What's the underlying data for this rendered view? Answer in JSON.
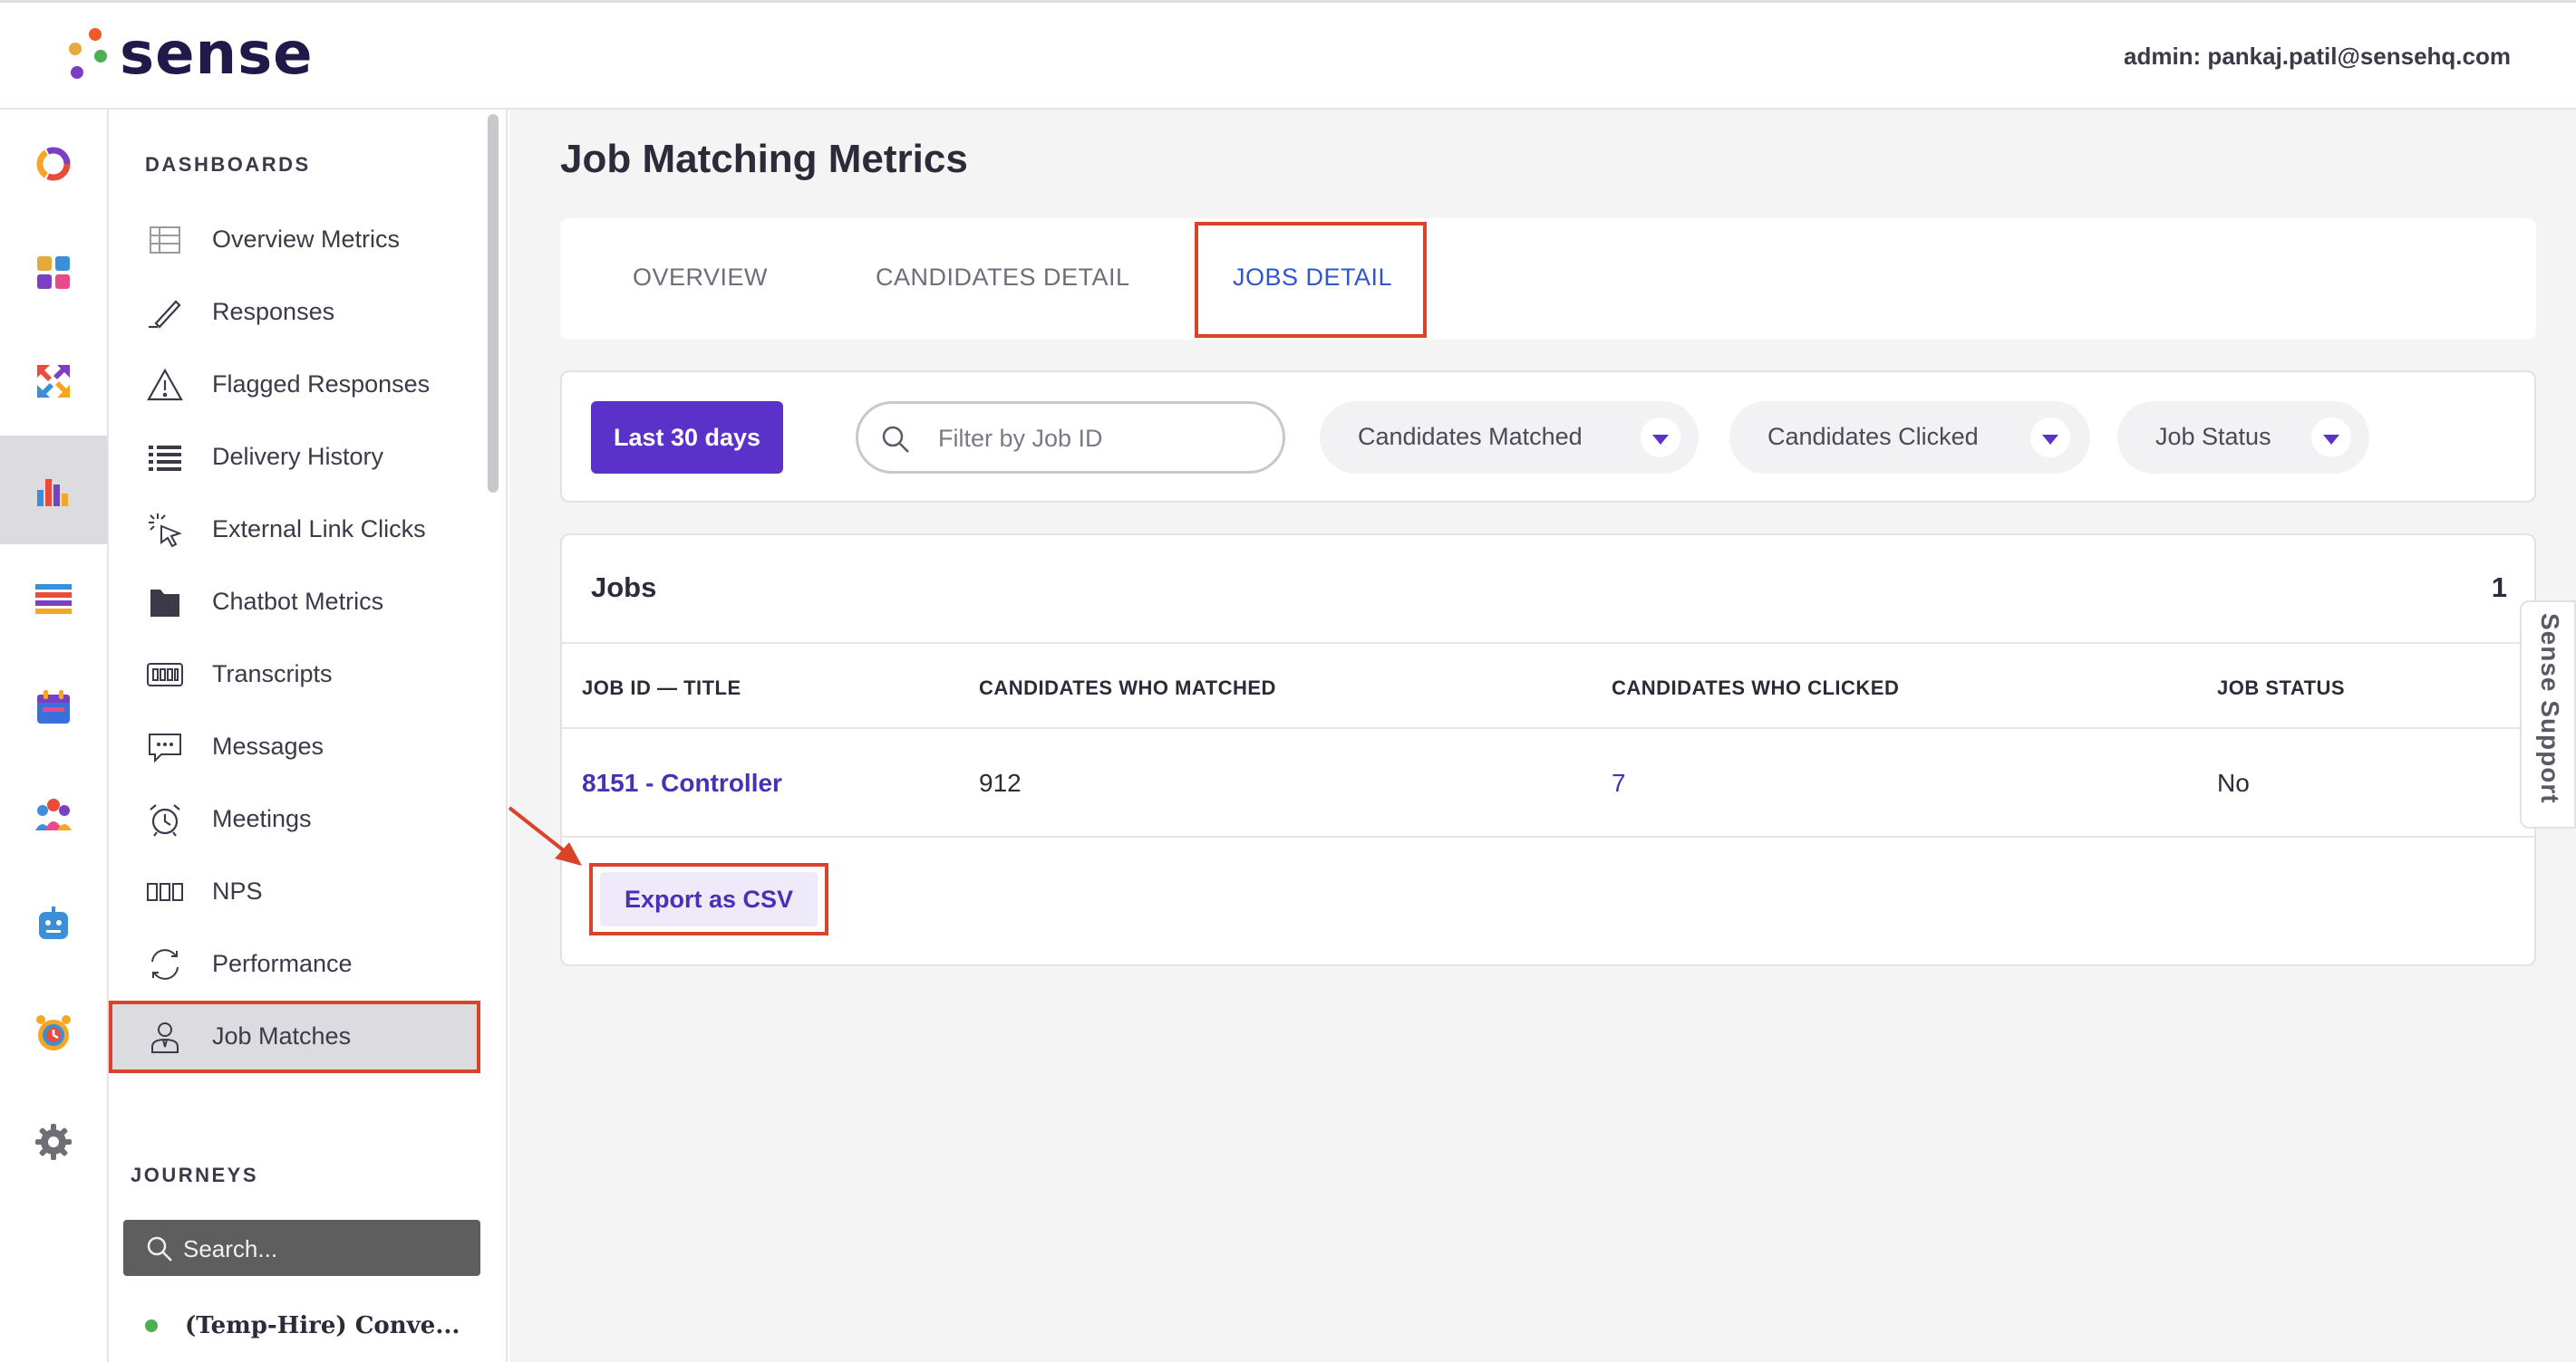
{
  "brand": {
    "name": "sense",
    "dot_colors": [
      "#f15a24",
      "#e8a93b",
      "#4caf50",
      "#7b3fc4",
      "#f5c542"
    ]
  },
  "header": {
    "admin": "admin: pankaj.patil@sensehq.com"
  },
  "rail": {
    "items": [
      {
        "icon": "ring-icon"
      },
      {
        "icon": "grid-icon"
      },
      {
        "icon": "arrows-icon"
      },
      {
        "icon": "bar-chart-icon",
        "active": true
      },
      {
        "icon": "list-icon"
      },
      {
        "icon": "calendar-icon"
      },
      {
        "icon": "team-icon"
      },
      {
        "icon": "bot-icon"
      },
      {
        "icon": "alarm-icon"
      },
      {
        "icon": "gear-icon"
      }
    ]
  },
  "sidebar": {
    "section_label": "DASHBOARDS",
    "items": [
      {
        "label": "Overview Metrics",
        "icon": "table-icon"
      },
      {
        "label": "Responses",
        "icon": "pen-icon"
      },
      {
        "label": "Flagged Responses",
        "icon": "warning-icon"
      },
      {
        "label": "Delivery History",
        "icon": "list-lines-icon"
      },
      {
        "label": "External Link Clicks",
        "icon": "pointer-click-icon"
      },
      {
        "label": "Chatbot Metrics",
        "icon": "folder-icon"
      },
      {
        "label": "Transcripts",
        "icon": "transcript-icon"
      },
      {
        "label": "Messages",
        "icon": "chat-icon"
      },
      {
        "label": "Meetings",
        "icon": "alarm-clock-icon"
      },
      {
        "label": "NPS",
        "icon": "nps-icon"
      },
      {
        "label": "Performance",
        "icon": "refresh-icon"
      },
      {
        "label": "Job Matches",
        "icon": "user-tie-icon",
        "active": true
      }
    ],
    "journeys_label": "JOURNEYS",
    "search_placeholder": "Search...",
    "journey_item": "(Temp-Hire) Conve..."
  },
  "main": {
    "title": "Job Matching Metrics",
    "tabs": [
      {
        "label": "OVERVIEW"
      },
      {
        "label": "CANDIDATES DETAIL"
      },
      {
        "label": "JOBS DETAIL",
        "active": true
      }
    ],
    "filters": {
      "date_button": "Last 30 days",
      "search_placeholder": "Filter by Job ID",
      "dropdowns": [
        "Candidates Matched",
        "Candidates Clicked",
        "Job Status"
      ]
    },
    "jobs": {
      "title": "Jobs",
      "count": "1",
      "columns": [
        "JOB ID — TITLE",
        "CANDIDATES WHO MATCHED",
        "CANDIDATES WHO CLICKED",
        "JOB STATUS"
      ],
      "rows": [
        [
          "8151 - Controller",
          "912",
          "7",
          "No"
        ]
      ],
      "export_label": "Export as CSV"
    }
  },
  "support_tab": "Sense Support",
  "colors": {
    "accent": "#5a31c9",
    "tab_active": "#2f57c9",
    "highlight": "#d84329"
  }
}
